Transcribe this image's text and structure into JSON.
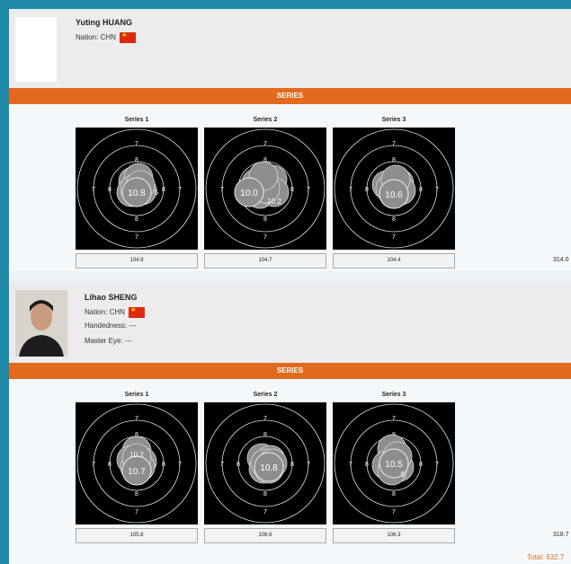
{
  "athletes": [
    {
      "name": "Yuting HUANG",
      "nation_label": "Nation: CHN",
      "series_header": "SERIES",
      "series": [
        {
          "title": "Series 1",
          "score": "104.9",
          "center_label": "10.8",
          "label_right": "5"
        },
        {
          "title": "Series 2",
          "score": "104.7",
          "center_label": "10.0",
          "label_right": "10.2"
        },
        {
          "title": "Series 3",
          "score": "104.4",
          "center_label": "10.6",
          "label_right": ""
        }
      ],
      "total": "314.0"
    },
    {
      "name": "Lihao SHENG",
      "nation_label": "Nation: CHN",
      "handedness": "Handedness: ---",
      "master_eye": "Master Eye: ---",
      "series_header": "SERIES",
      "series": [
        {
          "title": "Series 1",
          "score": "105.8",
          "center_label": "10.7",
          "label_right": "10.2"
        },
        {
          "title": "Series 2",
          "score": "106.6",
          "center_label": "10.8",
          "label_right": ""
        },
        {
          "title": "Series 3",
          "score": "106.3",
          "center_label": "10.5",
          "label_right": "5"
        }
      ],
      "total": "318.7"
    }
  ],
  "grand_total": "Total: 632.7",
  "ring_labels": {
    "seven": "7",
    "eight": "8"
  },
  "colors": {
    "accent": "#e26a1e",
    "frame": "#1e8aa8",
    "flag_red": "#de2910",
    "flag_star": "#ffde00"
  }
}
